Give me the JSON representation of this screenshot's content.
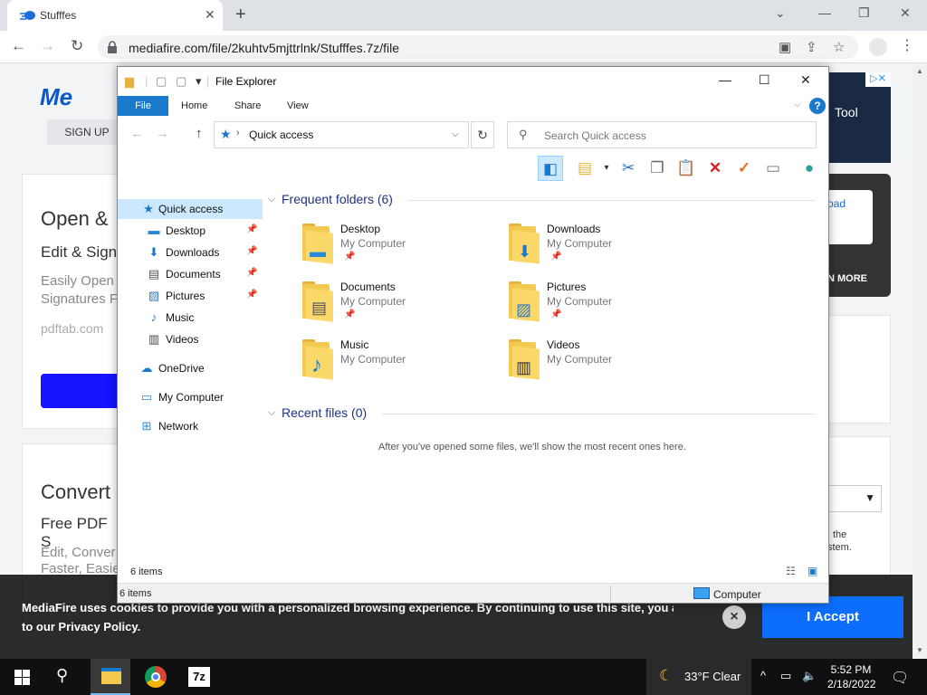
{
  "browser": {
    "tab_title": "Stufffes",
    "tab_close": "✕",
    "new_tab": "+",
    "minimize": "⌄",
    "restore": "—",
    "maximize": "❐",
    "close": "✕",
    "back": "←",
    "forward": "→",
    "reload": "↻",
    "url": "mediafire.com/file/2kuhtv5mjttrlnk/Stufffes.7z/file",
    "menu": "⋮"
  },
  "page": {
    "logo": "Me",
    "signup": "SIGN UP",
    "card1": {
      "heading": "Open &",
      "sub": "Edit & Sign",
      "body_1": "Easily Open",
      "body_2": "Signatures F",
      "site": "pdftab.com"
    },
    "card2": {
      "heading": "Convert",
      "sub": "Free PDF S",
      "body_1": "Edit, Conver",
      "body_2": "Faster, Easie"
    },
    "ad_text": "Tool",
    "ad_close": "▷✕",
    "dark_card_link": "oad",
    "dark_card_more": "N MORE",
    "side_text_1": "the",
    "side_text_2": "stem.",
    "select_arrow": "▼"
  },
  "cookie": {
    "text_1": "MediaFire uses cookies to provide you with a personalized browsing experience. By continuing to use this site, you agree",
    "text_2": "to our Privacy Policy.",
    "close": "×",
    "accept": "I Accept"
  },
  "explorer": {
    "title": "File Explorer",
    "qat_dropdown": "▾",
    "minimize": "—",
    "maximize": "☐",
    "close": "✕",
    "ribbon": {
      "file": "File",
      "home": "Home",
      "share": "Share",
      "view": "View",
      "collapse": "⌵",
      "help": "?"
    },
    "nav_back": "←",
    "nav_forward": "→",
    "nav_up": "↑",
    "address_sep": "›",
    "address": "Quick access",
    "address_dropdown": "⌵",
    "refresh": "↻",
    "search_placeholder": "Search Quick access",
    "navpane": [
      {
        "label": "Quick access",
        "icon": "★",
        "color": "#1979ca"
      },
      {
        "label": "Desktop",
        "icon": "▬",
        "color": "#2a8ad8"
      },
      {
        "label": "Downloads",
        "icon": "⬇",
        "color": "#1979ca"
      },
      {
        "label": "Documents",
        "icon": "▤",
        "color": "#555"
      },
      {
        "label": "Pictures",
        "icon": "▨",
        "color": "#3a7bb8"
      },
      {
        "label": "Music",
        "icon": "♪",
        "color": "#1979ca"
      },
      {
        "label": "Videos",
        "icon": "▥",
        "color": "#444"
      },
      {
        "label": "OneDrive",
        "icon": "☁",
        "color": "#1979ca"
      },
      {
        "label": "My Computer",
        "icon": "▭",
        "color": "#2a8ad8"
      },
      {
        "label": "Network",
        "icon": "⊞",
        "color": "#2a8ad8"
      }
    ],
    "pin": "📌",
    "frequent_header": "Frequent folders (6)",
    "folders": [
      {
        "name": "Desktop",
        "location": "My Computer",
        "badge": "▬",
        "badge_color": "#2a8ad8"
      },
      {
        "name": "Downloads",
        "location": "My Computer",
        "badge": "⬇",
        "badge_color": "#1979ca"
      },
      {
        "name": "Documents",
        "location": "My Computer",
        "badge": "▤",
        "badge_color": "#555"
      },
      {
        "name": "Pictures",
        "location": "My Computer",
        "badge": "▨",
        "badge_color": "#3a7bb8"
      },
      {
        "name": "Music",
        "location": "My Computer",
        "badge": "♪",
        "badge_color": "#1979ca"
      },
      {
        "name": "Videos",
        "location": "My Computer",
        "badge": "▥",
        "badge_color": "#333"
      }
    ],
    "recent_header": "Recent files (0)",
    "recent_empty": "After you've opened some files, we'll show the most recent ones here.",
    "items_count": "6 items",
    "status_left": "6 items",
    "status_right": "Computer",
    "collapse_chevron": "⌵"
  },
  "taskbar": {
    "search": "⚲",
    "seven_zip": "7z",
    "temperature": "33°F  Clear",
    "moon": "☾",
    "tray_up": "^",
    "tray_network": "▭",
    "tray_volume": "🔈",
    "time": "5:52 PM",
    "date": "2/18/2022",
    "notification": "🗨"
  }
}
